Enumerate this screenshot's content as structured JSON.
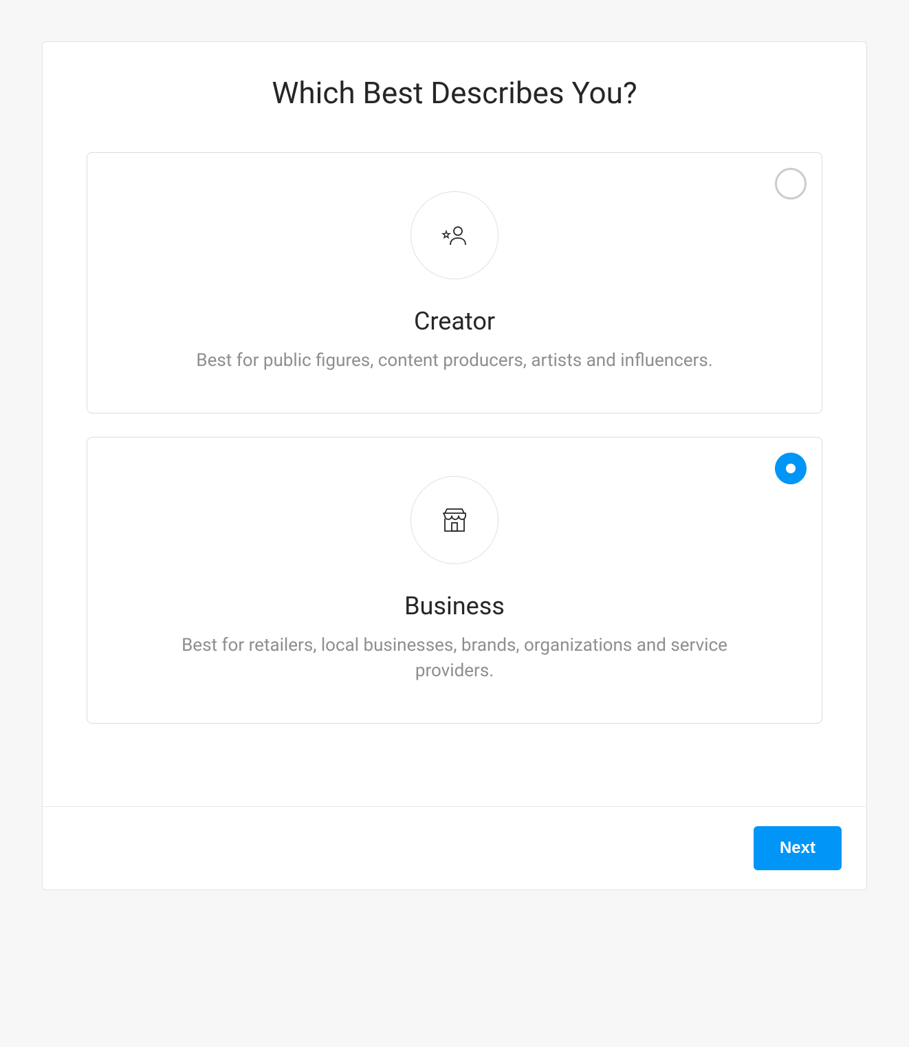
{
  "page": {
    "title": "Which Best Describes You?"
  },
  "options": [
    {
      "id": "creator",
      "title": "Creator",
      "description": "Best for public figures, content producers, artists and influencers.",
      "selected": false,
      "icon": "creator-icon"
    },
    {
      "id": "business",
      "title": "Business",
      "description": "Best for retailers, local businesses, brands, organizations and service providers.",
      "selected": true,
      "icon": "business-icon"
    }
  ],
  "footer": {
    "next_label": "Next"
  }
}
